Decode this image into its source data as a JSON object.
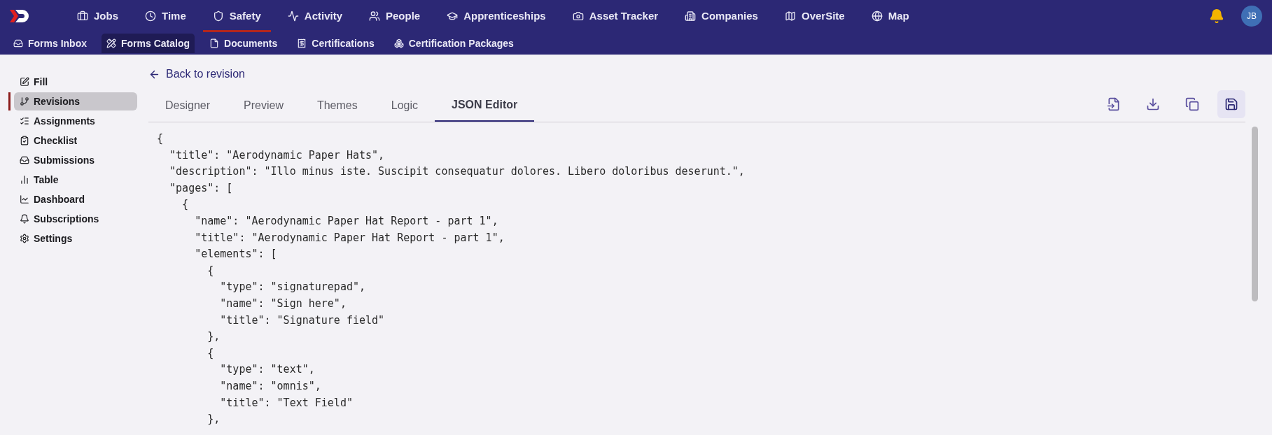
{
  "top_nav": [
    {
      "label": "Jobs",
      "selected": false
    },
    {
      "label": "Time",
      "selected": false
    },
    {
      "label": "Safety",
      "selected": true
    },
    {
      "label": "Activity",
      "selected": false
    },
    {
      "label": "People",
      "selected": false
    },
    {
      "label": "Apprenticeships",
      "selected": false
    },
    {
      "label": "Asset Tracker",
      "selected": false
    },
    {
      "label": "Companies",
      "selected": false
    },
    {
      "label": "OverSite",
      "selected": false
    },
    {
      "label": "Map",
      "selected": false
    }
  ],
  "user": {
    "initials": "JB"
  },
  "sub_nav": [
    {
      "label": "Forms Inbox",
      "selected": false
    },
    {
      "label": "Forms Catalog",
      "selected": true
    },
    {
      "label": "Documents",
      "selected": false
    },
    {
      "label": "Certifications",
      "selected": false
    },
    {
      "label": "Certification Packages",
      "selected": false
    }
  ],
  "sidebar": {
    "items": [
      {
        "label": "Fill",
        "selected": false
      },
      {
        "label": "Revisions",
        "selected": true
      },
      {
        "label": "Assignments",
        "selected": false
      },
      {
        "label": "Checklist",
        "selected": false
      },
      {
        "label": "Submissions",
        "selected": false
      },
      {
        "label": "Table",
        "selected": false
      },
      {
        "label": "Dashboard",
        "selected": false
      },
      {
        "label": "Subscriptions",
        "selected": false
      },
      {
        "label": "Settings",
        "selected": false
      }
    ]
  },
  "back_link": "Back to revision",
  "tabs": [
    {
      "label": "Designer",
      "selected": false
    },
    {
      "label": "Preview",
      "selected": false
    },
    {
      "label": "Themes",
      "selected": false
    },
    {
      "label": "Logic",
      "selected": false
    },
    {
      "label": "JSON Editor",
      "selected": true
    }
  ],
  "toolbar": [
    {
      "selected": false
    },
    {
      "selected": false
    },
    {
      "selected": false
    },
    {
      "selected": true
    }
  ],
  "code_lines": [
    "{",
    "  \"title\": \"Aerodynamic Paper Hats\",",
    "  \"description\": \"Illo minus iste. Suscipit consequatur dolores. Libero doloribus deserunt.\",",
    "  \"pages\": [",
    "    {",
    "      \"name\": \"Aerodynamic Paper Hat Report - part 1\",",
    "      \"title\": \"Aerodynamic Paper Hat Report - part 1\",",
    "      \"elements\": [",
    "        {",
    "          \"type\": \"signaturepad\",",
    "          \"name\": \"Sign here\",",
    "          \"title\": \"Signature field\"",
    "        },",
    "        {",
    "          \"type\": \"text\",",
    "          \"name\": \"omnis\",",
    "          \"title\": \"Text Field\"",
    "        },"
  ]
}
